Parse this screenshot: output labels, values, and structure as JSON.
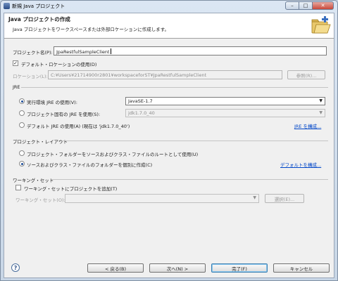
{
  "window": {
    "title": "新規 Java プロジェクト",
    "minimize": "–",
    "maximize": "□",
    "close": "✕"
  },
  "header": {
    "title": "Java プロジェクトの作成",
    "description": "Java プロジェクトをワークスペースまたは外部ロケーションに作成します。"
  },
  "project_name": {
    "label": "プロジェクト名(P):",
    "value": "JpaRestfulSampleClient"
  },
  "location": {
    "use_default_label": "デフォルト・ロケーションの使用(D)",
    "use_default_checked": true,
    "label": "ロケーション(L):",
    "value": "C:¥Users¥21714900r2801¥workspaceforST¥JpaRestfulSampleClient",
    "browse_label": "参照(R)..."
  },
  "jre": {
    "group_label": "JRE",
    "option_exec_env_label": "実行環境 JRE の使用(V):",
    "exec_env_value": "JavaSE-1.7",
    "option_project_specific_label": "プロジェクト固有の JRE を使用(S):",
    "project_specific_value": "jdk1.7.0_40",
    "option_default_label": "デフォルト JRE の使用(A) (現在は 'jdk1.7.0_40')",
    "configure_link": "JRE を構成..."
  },
  "layout": {
    "group_label": "プロジェクト・レイアウト",
    "option_root_label": "プロジェクト・フォルダーをソースおよびクラス・ファイルのルートとして使用(U)",
    "option_separate_label": "ソースおよびクラス・ファイルのフォルダーを個別に作成(C)",
    "configure_default_link": "デフォルトを構成..."
  },
  "working_sets": {
    "group_label": "ワーキング・セット",
    "add_label": "ワーキング・セットにプロジェクトを追加(T)",
    "add_checked": false,
    "field_label": "ワーキング・セット(O):",
    "select_label": "選択(E)..."
  },
  "footer": {
    "help_icon": "?",
    "back_label": "< 戻る(B)",
    "next_label": "次へ(N) >",
    "finish_label": "完了(F)",
    "cancel_label": "キャンセル"
  },
  "colors": {
    "link": "#0046c8",
    "accent": "#3c7fb1"
  }
}
